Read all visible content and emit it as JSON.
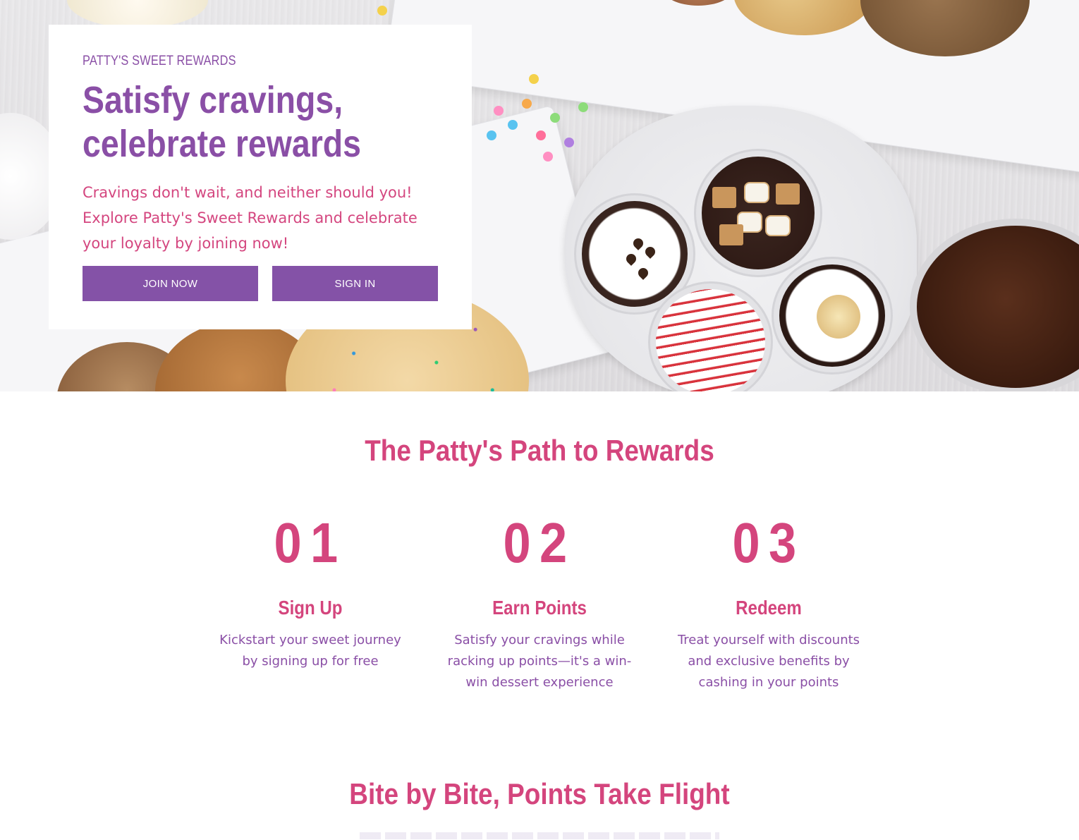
{
  "hero": {
    "eyebrow": "PATTY'S SWEET REWARDS",
    "title_line1": "Satisfy cravings,",
    "title_line2": "celebrate rewards",
    "description": "Cravings don't wait, and neither should you! Explore Patty's Sweet Rewards and celebrate your loyalty by joining now!",
    "join_label": "JOIN NOW",
    "signin_label": "SIGN IN"
  },
  "path": {
    "title": "The Patty's Path to Rewards",
    "steps": [
      {
        "number": "01",
        "title": "Sign Up",
        "description": "Kickstart your sweet journey by signing up for free"
      },
      {
        "number": "02",
        "title": "Earn Points",
        "description": "Satisfy your cravings while racking up points—it's a win-win dessert experience"
      },
      {
        "number": "03",
        "title": "Redeem",
        "description": "Treat yourself with discounts and exclusive benefits by cashing in your points"
      }
    ]
  },
  "bite": {
    "title": "Bite by Bite, Points Take Flight"
  },
  "colors": {
    "brand_purple": "#8452a7",
    "brand_pink": "#d4457d"
  }
}
